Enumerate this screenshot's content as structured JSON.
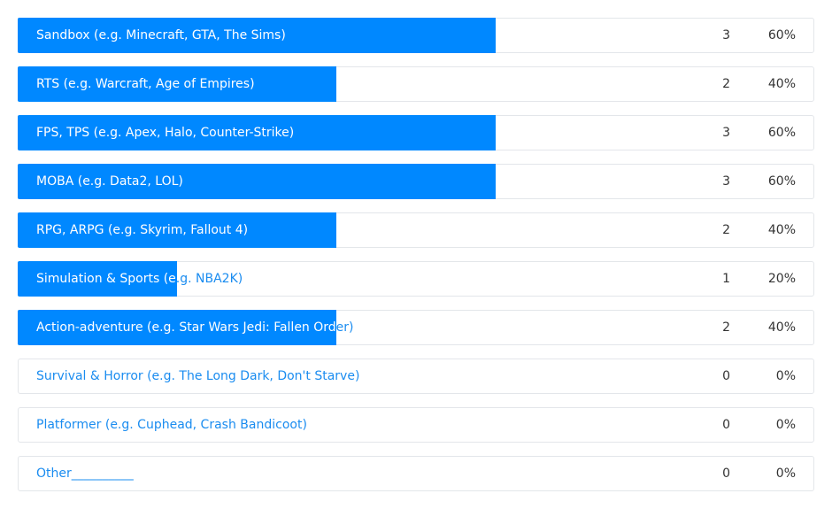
{
  "chart_data": {
    "type": "bar",
    "orientation": "horizontal",
    "max_percent": 100,
    "accent_color": "#0088ff",
    "label_color": "#1a8cf0",
    "categories": [
      "Sandbox (e.g. Minecraft, GTA, The Sims)",
      "RTS (e.g. Warcraft, Age of Empires)",
      "FPS, TPS (e.g. Apex, Halo, Counter-Strike)",
      "MOBA (e.g. Data2, LOL)",
      "RPG, ARPG (e.g. Skyrim, Fallout 4)",
      "Simulation & Sports (e.g. NBA2K)",
      "Action-adventure (e.g. Star Wars Jedi: Fallen Order)",
      "Survival & Horror (e.g. The Long Dark, Don't Starve)",
      "Platformer (e.g. Cuphead, Crash Bandicoot)",
      "Other__________"
    ],
    "counts": [
      3,
      2,
      3,
      3,
      2,
      1,
      2,
      0,
      0,
      0
    ],
    "percent_labels": [
      "60%",
      "40%",
      "60%",
      "60%",
      "40%",
      "20%",
      "40%",
      "0%",
      "0%",
      "0%"
    ],
    "values": [
      60,
      40,
      60,
      60,
      40,
      20,
      40,
      0,
      0,
      0
    ]
  }
}
